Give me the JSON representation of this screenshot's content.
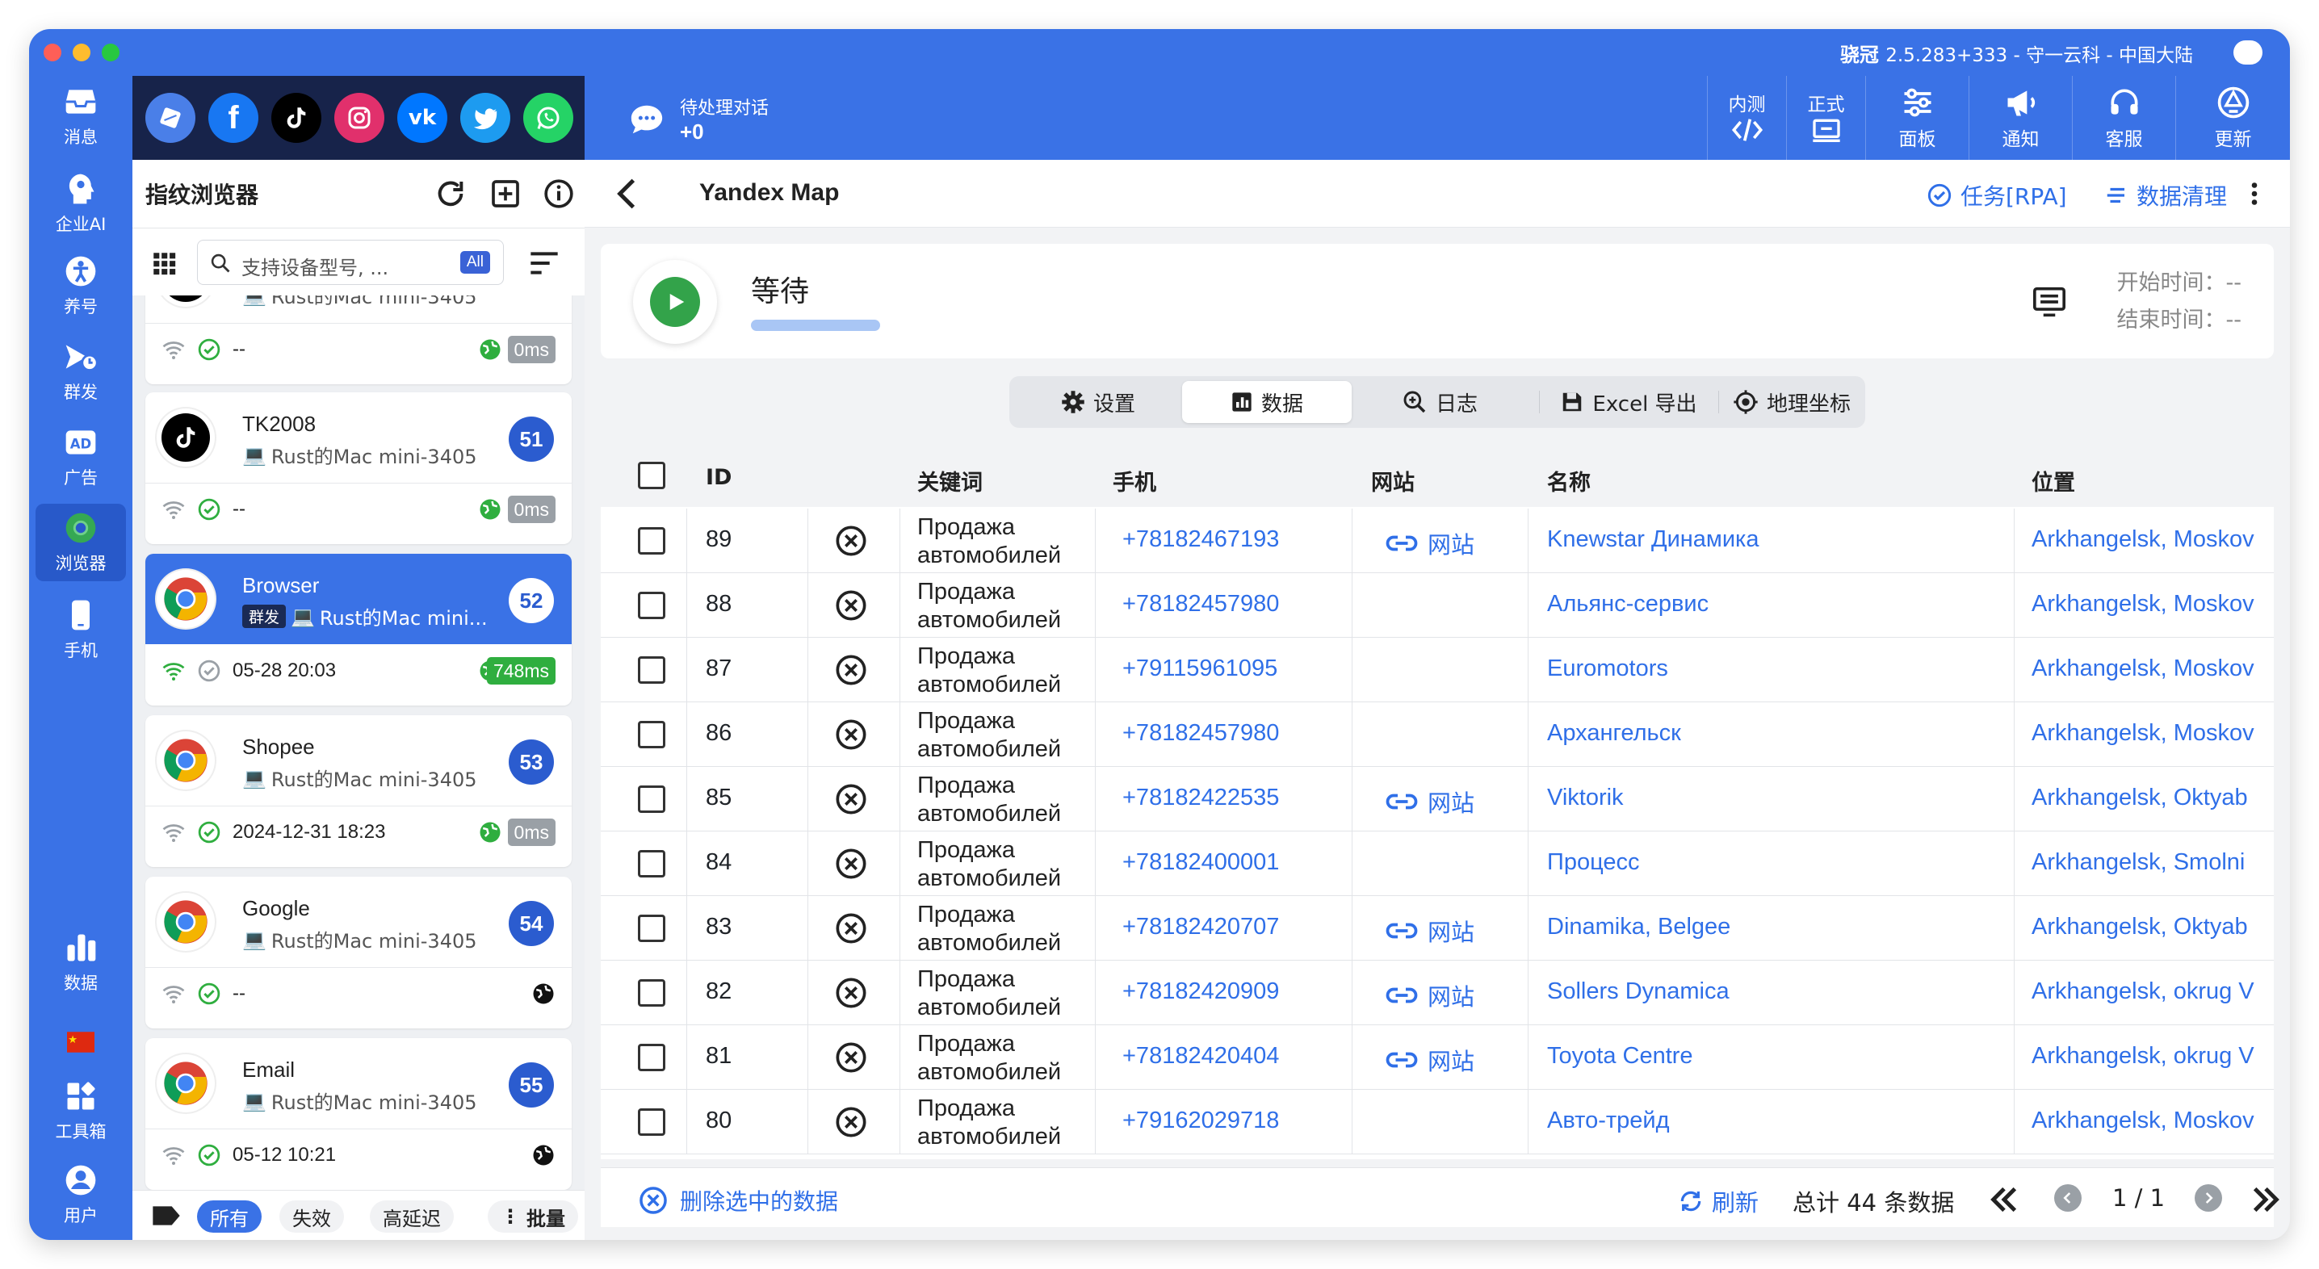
{
  "window": {
    "title_app": "骁冠",
    "title_version": "2.5.283+333 - 守一云科 - 中国大陆"
  },
  "leftnav": {
    "items": [
      {
        "label": "消息",
        "icon": "inbox-icon"
      },
      {
        "label": "企业AI",
        "icon": "ai-icon"
      },
      {
        "label": "养号",
        "icon": "person-icon"
      },
      {
        "label": "群发",
        "icon": "broadcast-icon"
      },
      {
        "label": "广告",
        "icon": "ad-icon"
      },
      {
        "label": "浏览器",
        "icon": "chrome-icon"
      },
      {
        "label": "手机",
        "icon": "phone-icon"
      }
    ],
    "bottom_items": [
      {
        "label": "数据",
        "icon": "bar-chart-icon"
      },
      {
        "label": "",
        "icon": "china-flag-icon"
      },
      {
        "label": "工具箱",
        "icon": "toolbox-icon"
      },
      {
        "label": "用户",
        "icon": "user-icon"
      }
    ]
  },
  "browser_panel": {
    "title": "指纹浏览器",
    "search_placeholder": "支持设备型号, ...",
    "search_badge": "All",
    "cards": [
      {
        "name": "",
        "device": "Rust的Mac mini-3405",
        "status": "--",
        "ms": "0ms",
        "number": ""
      },
      {
        "name": "TK2008",
        "device": "Rust的Mac mini-3405",
        "status": "--",
        "ms": "0ms",
        "number": "51"
      },
      {
        "name": "Browser",
        "tag": "群发",
        "device": "Rust的Mac mini...",
        "status": "05-28 20:03",
        "ms": "748ms",
        "number": "52"
      },
      {
        "name": "Shopee",
        "device": "Rust的Mac mini-3405",
        "status": "2024-12-31 18:23",
        "ms": "0ms",
        "number": "53"
      },
      {
        "name": "Google",
        "device": "Rust的Mac mini-3405",
        "status": "--",
        "ms": "",
        "number": "54"
      },
      {
        "name": "Email",
        "device": "Rust的Mac mini-3405",
        "status": "05-12 10:21",
        "ms": "",
        "number": "55"
      }
    ],
    "filters": {
      "all": "所有",
      "invalid": "失效",
      "high_latency": "高延迟",
      "batch": "批量"
    }
  },
  "topbar": {
    "pending_label": "待处理对话",
    "pending_count": "+0",
    "buttons": [
      {
        "label": "内测",
        "icon": "code-icon"
      },
      {
        "label": "正式",
        "icon": "release-icon"
      },
      {
        "label": "面板",
        "icon": "sliders-icon"
      },
      {
        "label": "通知",
        "icon": "megaphone-icon"
      },
      {
        "label": "客服",
        "icon": "headset-icon"
      },
      {
        "label": "更新",
        "icon": "update-icon"
      }
    ]
  },
  "main": {
    "title": "Yandex Map",
    "task_link": "任务[RPA]",
    "clean_link": "数据清理",
    "status": "等待",
    "start_time": "开始时间：--",
    "end_time": "结束时间：--",
    "tabs": [
      {
        "label": "设置",
        "icon": "gear-icon"
      },
      {
        "label": "数据",
        "icon": "data-icon"
      },
      {
        "label": "日志",
        "icon": "log-icon"
      },
      {
        "label": "Excel 导出",
        "icon": "save-icon"
      },
      {
        "label": "地理坐标",
        "icon": "target-icon"
      }
    ],
    "columns": [
      "ID",
      "关键词",
      "手机",
      "网站",
      "名称",
      "位置"
    ],
    "rows": [
      {
        "id": "89",
        "keyword": "Продажа автомобилей",
        "phone": "+78182467193",
        "website": "网站",
        "name": "Knewstar Динамика",
        "location": "Arkhangelsk, Moskov"
      },
      {
        "id": "88",
        "keyword": "Продажа автомобилей",
        "phone": "+78182457980",
        "website": "",
        "name": "Альянс-сервис",
        "location": "Arkhangelsk, Moskov"
      },
      {
        "id": "87",
        "keyword": "Продажа автомобилей",
        "phone": "+79115961095",
        "website": "",
        "name": "Euromotors",
        "location": "Arkhangelsk, Moskov"
      },
      {
        "id": "86",
        "keyword": "Продажа автомобилей",
        "phone": "+78182457980",
        "website": "",
        "name": "Архангельск",
        "location": "Arkhangelsk, Moskov"
      },
      {
        "id": "85",
        "keyword": "Продажа автомобилей",
        "phone": "+78182422535",
        "website": "网站",
        "name": "Viktorik",
        "location": "Arkhangelsk, Oktyab"
      },
      {
        "id": "84",
        "keyword": "Продажа автомобилей",
        "phone": "+78182400001",
        "website": "",
        "name": "Процесс",
        "location": "Arkhangelsk, Smolni"
      },
      {
        "id": "83",
        "keyword": "Продажа автомобилей",
        "phone": "+78182420707",
        "website": "网站",
        "name": "Dinamika, Belgee",
        "location": "Arkhangelsk, Oktyab"
      },
      {
        "id": "82",
        "keyword": "Продажа автомобилей",
        "phone": "+78182420909",
        "website": "网站",
        "name": "Sollers Dynamica",
        "location": "Arkhangelsk, okrug V"
      },
      {
        "id": "81",
        "keyword": "Продажа автомобилей",
        "phone": "+78182420404",
        "website": "网站",
        "name": "Toyota Centre",
        "location": "Arkhangelsk, okrug V"
      },
      {
        "id": "80",
        "keyword": "Продажа автомобилей",
        "phone": "+79162029718",
        "website": "",
        "name": "Авто-трейд",
        "location": "Arkhangelsk, Moskov"
      }
    ],
    "footer": {
      "delete_label": "删除选中的数据",
      "refresh_label": "刷新",
      "total": "总计 44 条数据",
      "page": "1 / 1"
    }
  },
  "colors": {
    "brand": "#3a72e6",
    "link": "#2f6fe8",
    "green": "#33a34a"
  }
}
